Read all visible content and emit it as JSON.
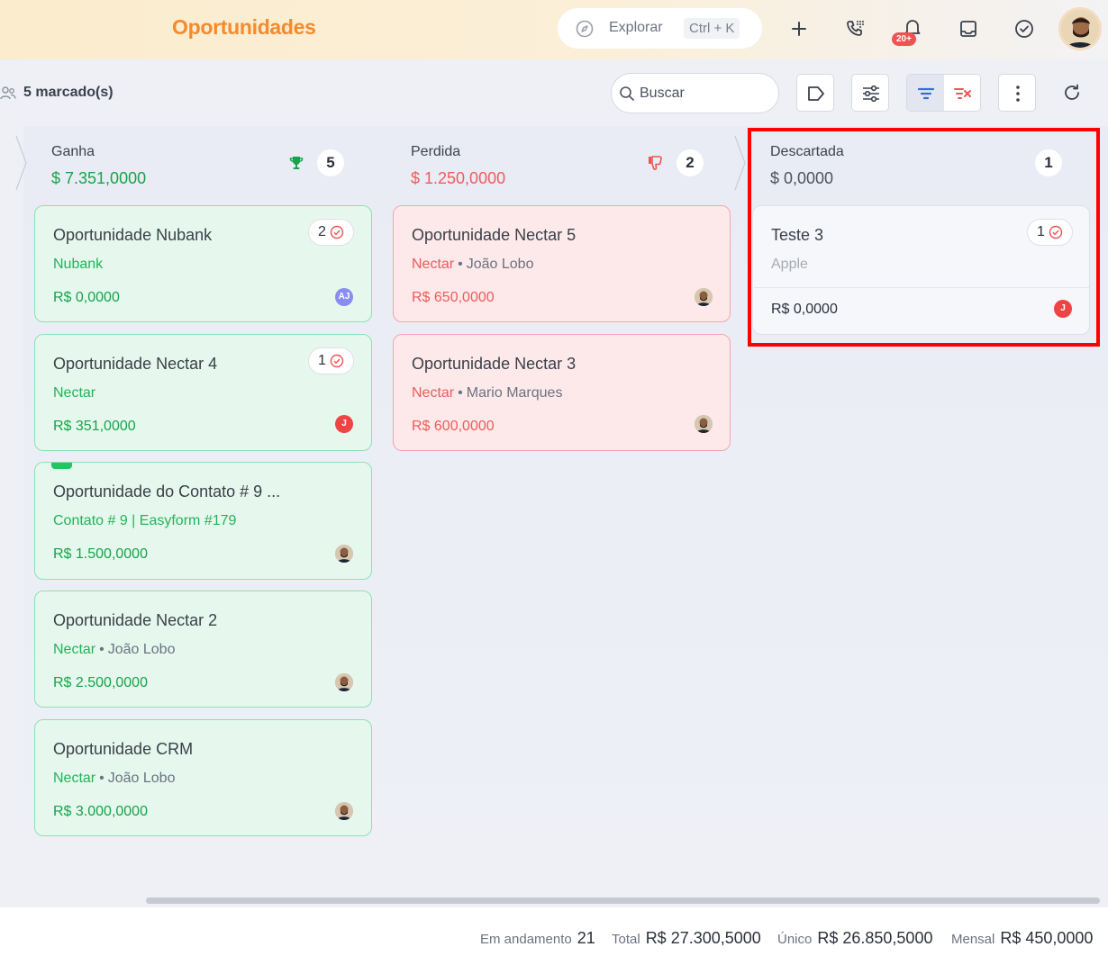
{
  "header": {
    "title": "Oportunidades",
    "explore_label": "Explorar",
    "explore_shortcut": "Ctrl + K",
    "notification_badge": "20+"
  },
  "toolbar": {
    "marked_label": "5 marcado(s)",
    "search_placeholder": "Buscar"
  },
  "columns": [
    {
      "name": "Ganha",
      "total": "$ 7.351,0000",
      "count": "5",
      "color": "#16a34a",
      "cards": [
        {
          "title": "Oportunidade Nubank",
          "company": "Nubank",
          "contact": "",
          "value": "R$ 0,0000",
          "tasks": "2",
          "avatar": "AJ"
        },
        {
          "title": "Oportunidade Nectar 4",
          "company": "Nectar",
          "contact": "",
          "value": "R$ 351,0000",
          "tasks": "1",
          "avatar": "J"
        },
        {
          "title": "Oportunidade do Contato # 9 ...",
          "company": "Contato # 9 | Easyform #179",
          "contact": "",
          "value": "R$ 1.500,0000",
          "tasks": "",
          "avatar": "photo"
        },
        {
          "title": "Oportunidade Nectar 2",
          "company": "Nectar",
          "contact": "João Lobo",
          "value": "R$ 2.500,0000",
          "tasks": "",
          "avatar": "photo"
        },
        {
          "title": "Oportunidade CRM",
          "company": "Nectar",
          "contact": "João Lobo",
          "value": "R$ 3.000,0000",
          "tasks": "",
          "avatar": "photo"
        }
      ]
    },
    {
      "name": "Perdida",
      "total": "$ 1.250,0000",
      "count": "2",
      "color": "#f05a5a",
      "cards": [
        {
          "title": "Oportunidade Nectar 5",
          "company": "Nectar",
          "contact": "João Lobo",
          "value": "R$ 650,0000",
          "tasks": "",
          "avatar": "photo"
        },
        {
          "title": "Oportunidade Nectar 3",
          "company": "Nectar",
          "contact": "Mario Marques",
          "value": "R$ 600,0000",
          "tasks": "",
          "avatar": "photo"
        }
      ]
    },
    {
      "name": "Descartada",
      "total": "$ 0,0000",
      "count": "1",
      "color": "#4b5260",
      "cards": [
        {
          "title": "Teste 3",
          "company": "Apple",
          "contact": "",
          "value": "R$ 0,0000",
          "tasks": "1",
          "avatar": "J"
        }
      ]
    }
  ],
  "footer": {
    "in_progress_label": "Em andamento",
    "in_progress_value": "21",
    "total_label": "Total",
    "total_value": "R$ 27.300,5000",
    "unique_label": "Único",
    "unique_value": "R$ 26.850,5000",
    "monthly_label": "Mensal",
    "monthly_value": "R$ 450,0000"
  }
}
